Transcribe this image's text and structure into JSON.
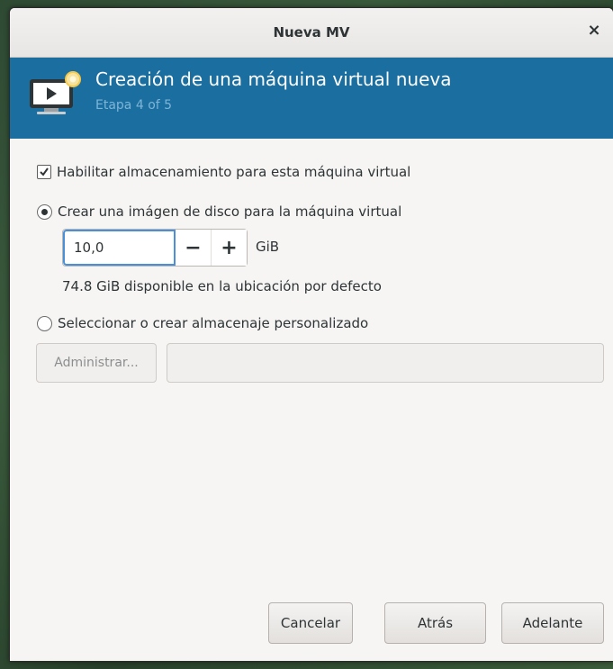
{
  "window": {
    "title": "Nueva MV",
    "close_glyph": "×"
  },
  "header": {
    "title": "Creación de una máquina virtual nueva",
    "step": "Etapa 4 of 5",
    "icon": "vm-screen-icon"
  },
  "storage": {
    "enable_label": "Habilitar almacenamiento para esta máquina virtual",
    "enable_checked": true,
    "create_image_label": "Crear una imágen de disco para la máquina virtual",
    "create_image_selected": true,
    "size_value": "10,0",
    "size_unit": "GiB",
    "decrement_glyph": "−",
    "increment_glyph": "+",
    "available_text": "74.8 GiB disponible en la ubicación por defecto",
    "custom_label": "Seleccionar o crear almacenaje personalizado",
    "custom_selected": false,
    "manage_label": "Administrar...",
    "custom_path_value": ""
  },
  "footer": {
    "cancel_label": "Cancelar",
    "back_label": "Atrás",
    "forward_label": "Adelante"
  },
  "colors": {
    "header_bg": "#1b6fa0",
    "step_text": "#7fb4d6",
    "focus": "#4a90d9"
  }
}
